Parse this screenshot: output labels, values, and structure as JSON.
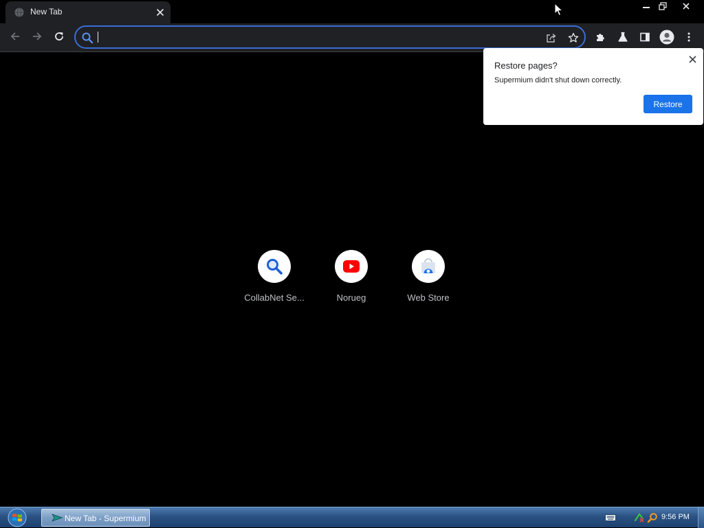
{
  "window": {
    "tab_title": "New Tab"
  },
  "toolbar": {
    "address_value": "",
    "address_placeholder": ""
  },
  "shortcuts": [
    {
      "label": "CollabNet Se...",
      "icon": "magnifier-icon"
    },
    {
      "label": "Norueg",
      "icon": "youtube-icon"
    },
    {
      "label": "Web Store",
      "icon": "web-store-icon"
    }
  ],
  "restore_bubble": {
    "title": "Restore pages?",
    "message": "Supermium didn't shut down correctly.",
    "button_label": "Restore"
  },
  "taskbar": {
    "app_label": "New Tab - Supermium",
    "clock": "9:56 PM"
  },
  "colors": {
    "page_background": "#000000",
    "toolbar_background": "#202124",
    "omnibox_focus_ring": "#3a6dd8",
    "restore_button": "#1a73e8",
    "youtube_red": "#ff0000",
    "taskbar_blue": "#2a5283"
  }
}
